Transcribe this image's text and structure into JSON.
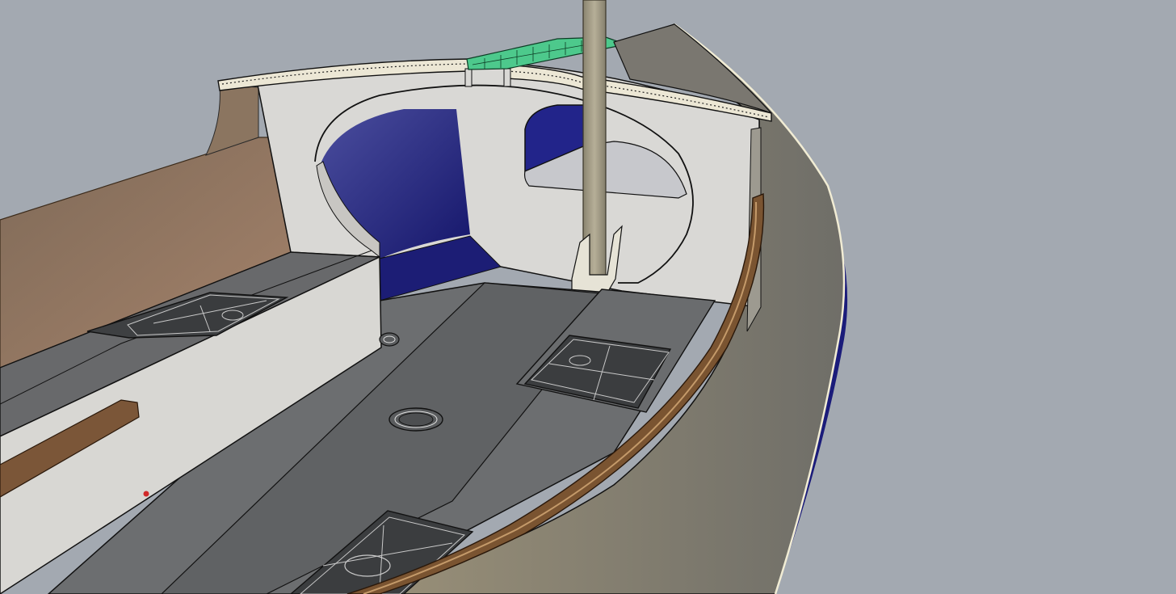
{
  "viewport": {
    "title": "",
    "view_mode": "rendered-perspective",
    "colors": {
      "background": "#a3a9b1",
      "hull_navy": "#1c1d78",
      "deck_gray": "#686a6c",
      "bulkhead_white": "#d6d5d2",
      "wood_brown": "#8f765c",
      "rail_brown": "#6a4a2a",
      "gunwale_taupe": "#86837a",
      "selection_green": "#4dc98c",
      "mast_tan": "#9b9480"
    }
  },
  "scene": {
    "objects": [
      "hull",
      "gunwale",
      "coaming",
      "forward-bulkhead",
      "bulkhead-opening",
      "mast",
      "mast-step",
      "cockpit-floor",
      "side-bench",
      "hatch-cover",
      "drain-fitting",
      "selected-deck-beam"
    ]
  }
}
